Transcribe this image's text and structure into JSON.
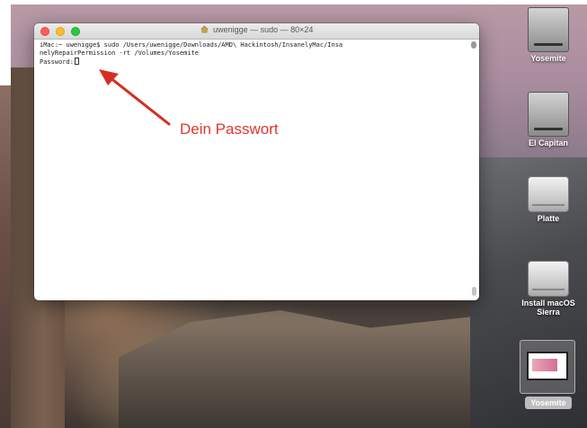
{
  "terminal": {
    "title": "uwenigge — sudo — 80×24",
    "lines": [
      "iMac:~ uwenigge$ sudo /Users/uwenigge/Downloads/AMD\\ Hackintosh/InsanelyMac/Insa",
      "nelyRepairPermission -rt /Volumes/Yosemite"
    ],
    "prompt": "Password:"
  },
  "annotation": {
    "text": "Dein Passwort",
    "color": "#e0372d"
  },
  "desktop": {
    "icons": [
      {
        "label": "Yosemite",
        "icon": "hard-drive-icon"
      },
      {
        "label": "El Capitan",
        "icon": "hard-drive-icon"
      },
      {
        "label": "Platte",
        "icon": "external-drive-icon"
      },
      {
        "label": "Install macOS Sierra",
        "icon": "external-drive-icon"
      },
      {
        "label": "Yosemite",
        "icon": "screenshot-thumbnail-icon",
        "selected": true
      }
    ]
  }
}
